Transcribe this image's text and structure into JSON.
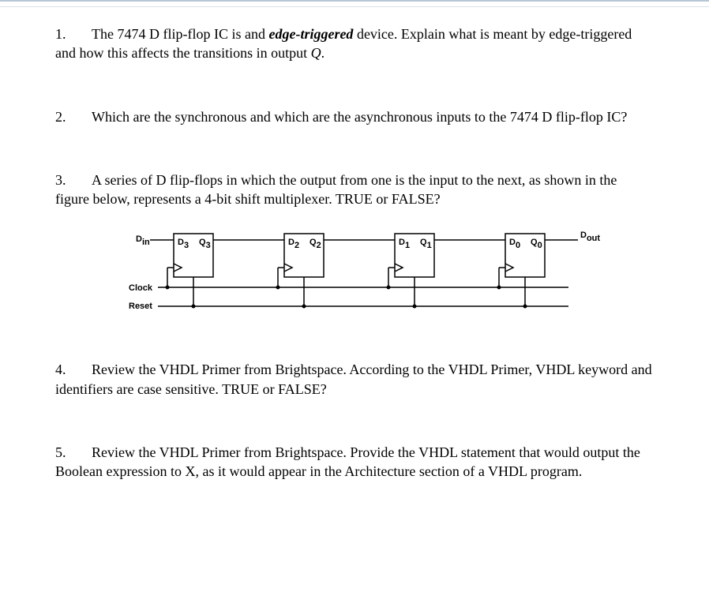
{
  "q1": {
    "num": "1.",
    "text_a": "The 7474 D flip-flop IC is and ",
    "text_emph": "edge-triggered",
    "text_b": " device.  Explain what is meant by edge-triggered and how this affects the transitions in output ",
    "text_ital": "Q",
    "text_c": "."
  },
  "q2": {
    "num": "2.",
    "text": "Which are the synchronous and which are the asynchronous inputs to the 7474 D flip-flop IC?"
  },
  "q3": {
    "num": "3.",
    "text": "A series of D flip-flops in which the output from one is the input to the next, as shown in the figure below, represents a 4-bit shift multiplexer.  TRUE or FALSE?"
  },
  "q4": {
    "num": "4.",
    "text": "Review the VHDL Primer from Brightspace.  According to the VHDL Primer, VHDL keyword and identifiers are case sensitive.  TRUE or FALSE?"
  },
  "q5": {
    "num": "5.",
    "text": "Review the VHDL Primer from Brightspace.  Provide the VHDL statement that would output the Boolean expression to X, as it would appear in the Architecture section of a VHDL program."
  },
  "figure": {
    "din_label": "D",
    "din_sub": "in",
    "dout_label": "D",
    "dout_sub": "out",
    "clock_label": "Clock",
    "reset_label": "Reset",
    "ff": [
      {
        "d": "D",
        "d_sub": "3",
        "q": "Q",
        "q_sub": "3"
      },
      {
        "d": "D",
        "d_sub": "2",
        "q": "Q",
        "q_sub": "2"
      },
      {
        "d": "D",
        "d_sub": "1",
        "q": "Q",
        "q_sub": "1"
      },
      {
        "d": "D",
        "d_sub": "0",
        "q": "Q",
        "q_sub": "0"
      }
    ]
  }
}
